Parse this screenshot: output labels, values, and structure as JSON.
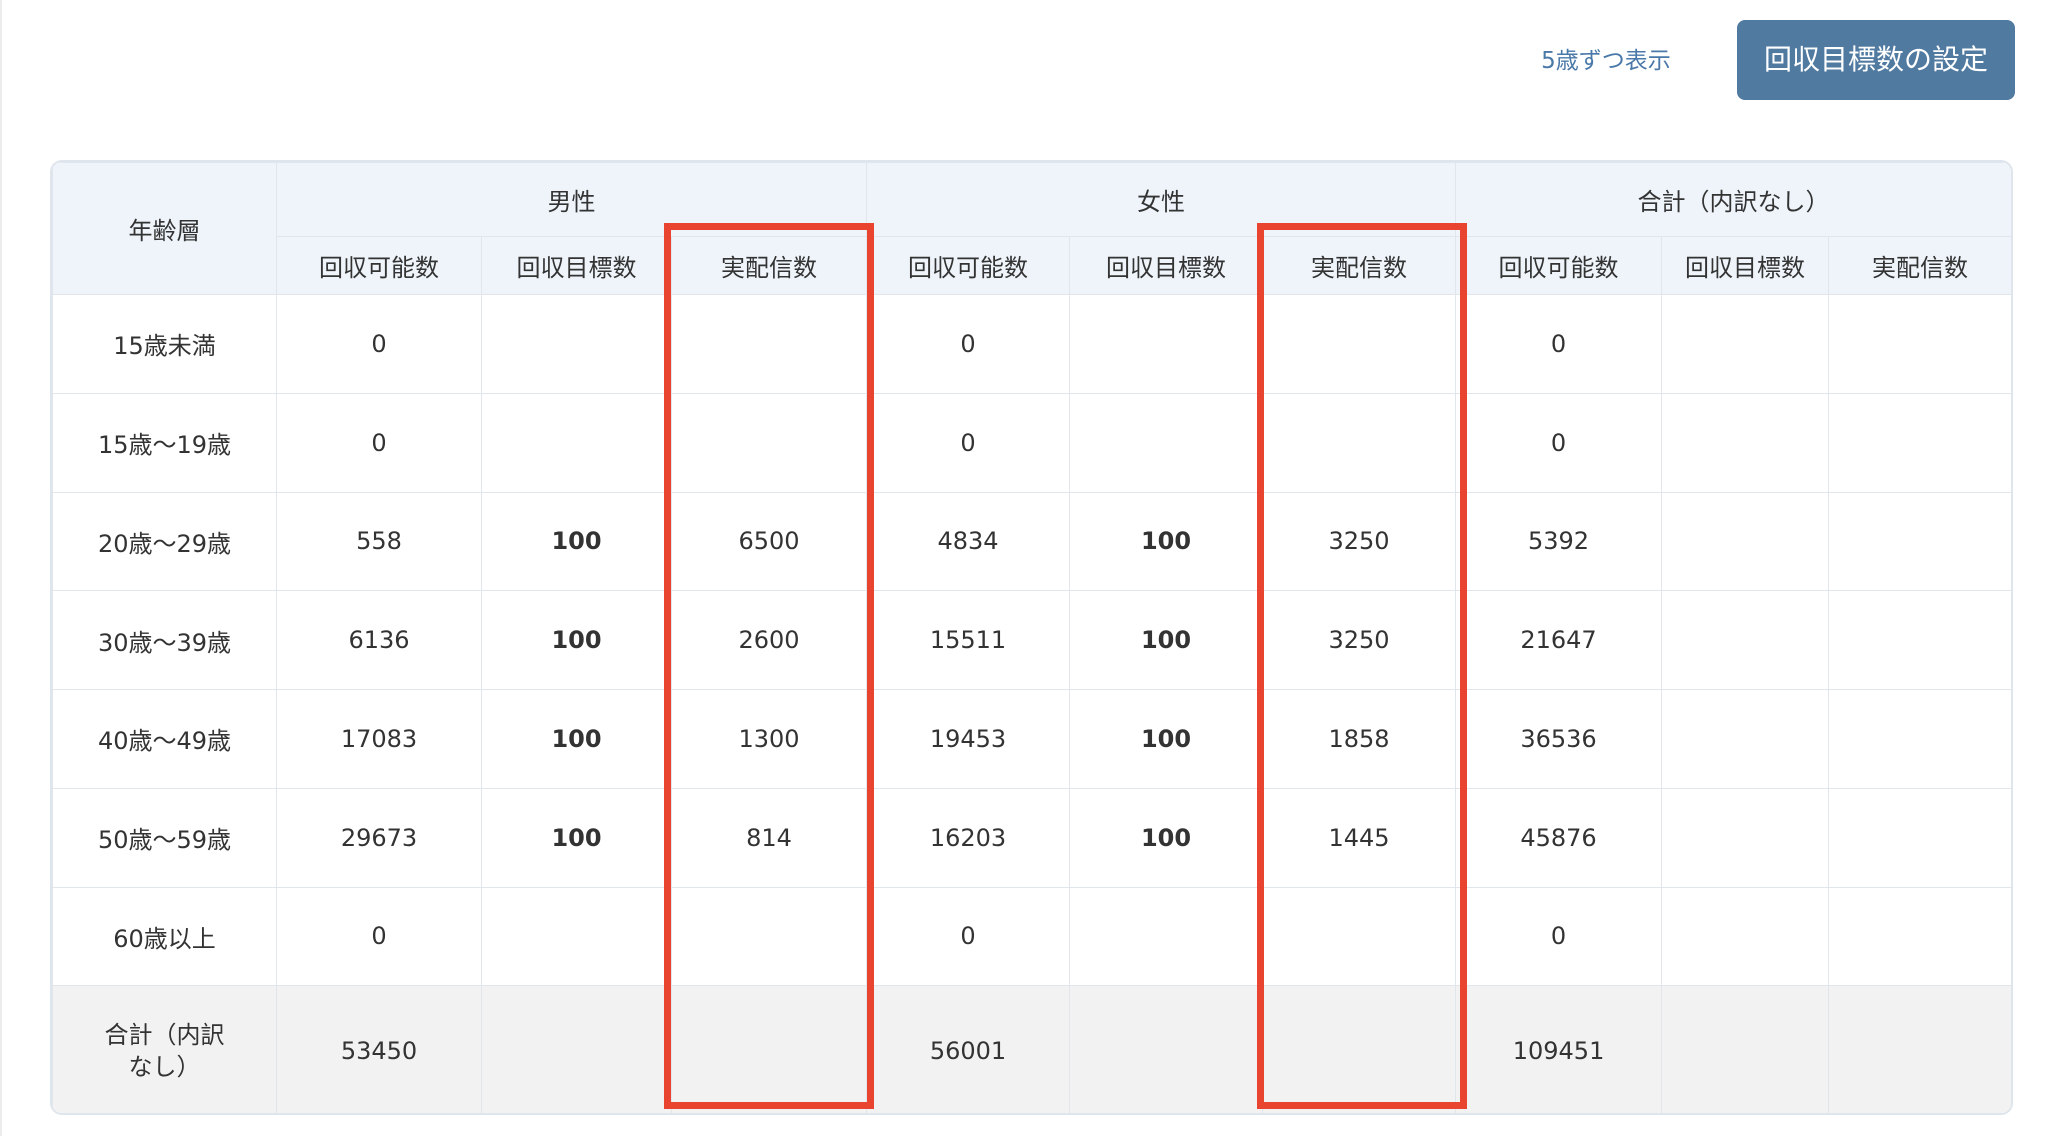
{
  "toolbar": {
    "link_label": "5歳ずつ表示",
    "button_label": "回収目標数の設定"
  },
  "table": {
    "age_header": "年齢層",
    "groups": [
      "男性",
      "女性",
      "合計（内訳なし）"
    ],
    "columns": [
      "回収可能数",
      "回収目標数",
      "実配信数",
      "回収可能数",
      "回収目標数",
      "実配信数",
      "回収可能数",
      "回収目標数",
      "実配信数"
    ],
    "rows": [
      {
        "age": "15歳未満",
        "cells": [
          "0",
          "",
          "",
          "0",
          "",
          "",
          "0",
          "",
          ""
        ]
      },
      {
        "age": "15歳〜19歳",
        "cells": [
          "0",
          "",
          "",
          "0",
          "",
          "",
          "0",
          "",
          ""
        ]
      },
      {
        "age": "20歳〜29歳",
        "cells": [
          "558",
          "100",
          "6500",
          "4834",
          "100",
          "3250",
          "5392",
          "",
          ""
        ]
      },
      {
        "age": "30歳〜39歳",
        "cells": [
          "6136",
          "100",
          "2600",
          "15511",
          "100",
          "3250",
          "21647",
          "",
          ""
        ]
      },
      {
        "age": "40歳〜49歳",
        "cells": [
          "17083",
          "100",
          "1300",
          "19453",
          "100",
          "1858",
          "36536",
          "",
          ""
        ]
      },
      {
        "age": "50歳〜59歳",
        "cells": [
          "29673",
          "100",
          "814",
          "16203",
          "100",
          "1445",
          "45876",
          "",
          ""
        ]
      },
      {
        "age": "60歳以上",
        "cells": [
          "0",
          "",
          "",
          "0",
          "",
          "",
          "0",
          "",
          ""
        ]
      }
    ],
    "total_row": {
      "label": "合計（内訳なし）",
      "cells": [
        "53450",
        "",
        "",
        "56001",
        "",
        "",
        "109451",
        "",
        ""
      ]
    }
  },
  "colors": {
    "highlight": "#e8442f",
    "button_bg": "#517aa1",
    "link": "#4a79a9",
    "header_bg": "#eef4fa"
  }
}
